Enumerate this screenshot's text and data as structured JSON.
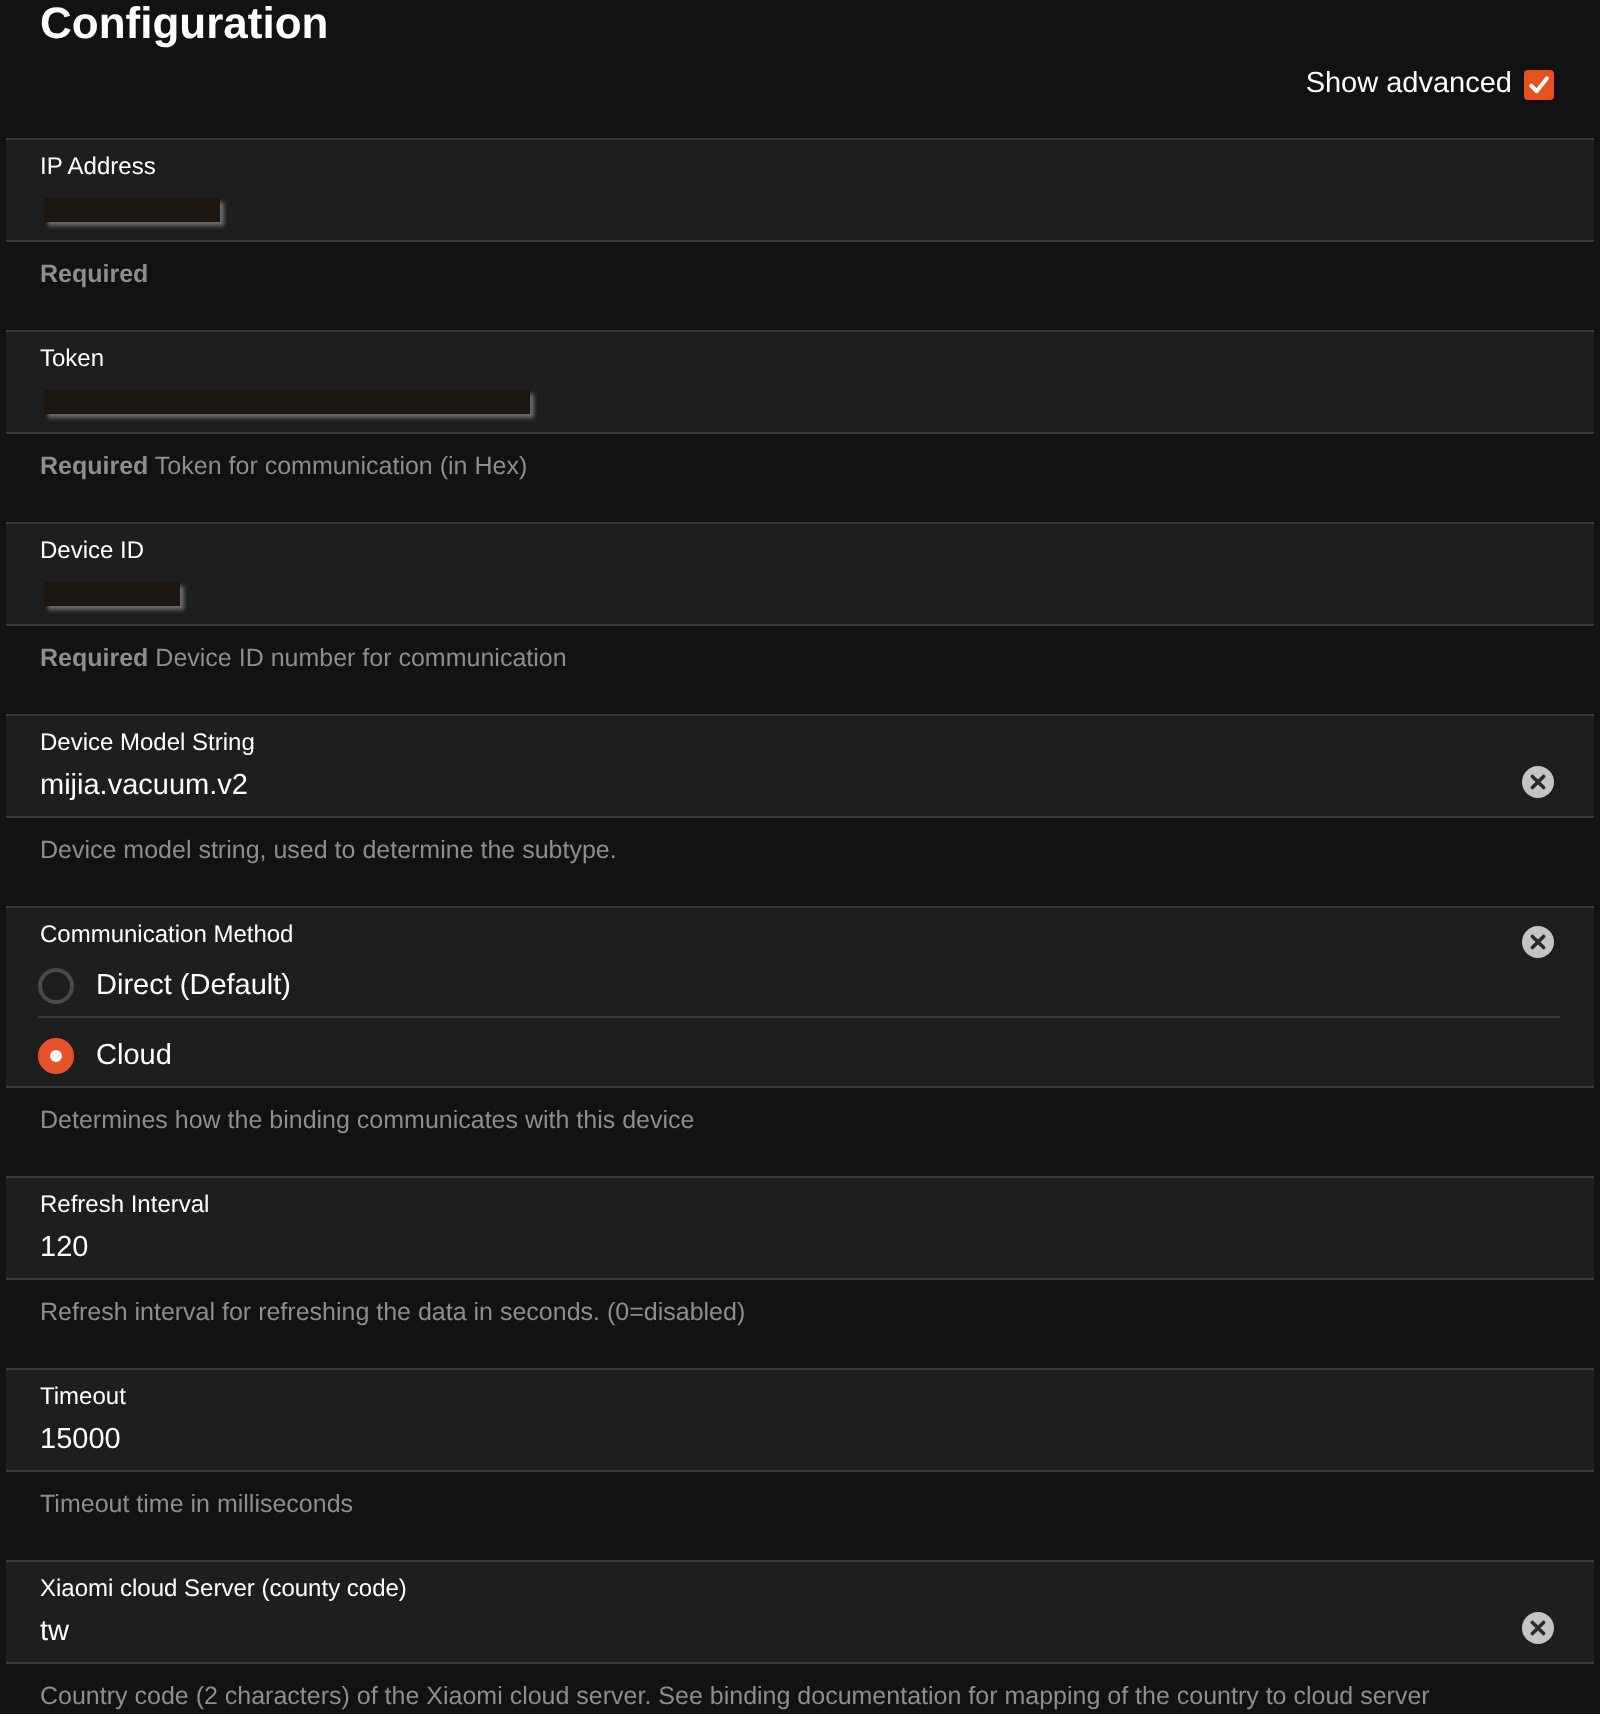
{
  "page": {
    "title": "Configuration"
  },
  "show_advanced": {
    "label": "Show advanced",
    "checked": true
  },
  "fields": [
    {
      "kind": "text",
      "label": "IP Address",
      "redacted": true,
      "clearable": false,
      "required": "Required"
    },
    {
      "kind": "text",
      "label": "Token",
      "redacted": true,
      "clearable": false,
      "required": "Required",
      "hint": "Token for communication (in Hex)"
    },
    {
      "kind": "text",
      "label": "Device ID",
      "redacted": true,
      "clearable": false,
      "required": "Required",
      "hint": "Device ID number for communication"
    },
    {
      "kind": "text",
      "label": "Device Model String",
      "value": "mijia.vacuum.v2",
      "redacted": false,
      "clearable": true,
      "hint": "Device model string, used to determine the subtype."
    },
    {
      "kind": "radio",
      "label": "Communication Method",
      "clearable": true,
      "options": [
        {
          "label": "Direct (Default)",
          "selected": false
        },
        {
          "label": "Cloud",
          "selected": true
        }
      ],
      "hint": "Determines how the binding communicates with this device"
    },
    {
      "kind": "text",
      "label": "Refresh Interval",
      "value": "120",
      "redacted": false,
      "clearable": false,
      "hint": "Refresh interval for refreshing the data in seconds. (0=disabled)"
    },
    {
      "kind": "text",
      "label": "Timeout",
      "value": "15000",
      "redacted": false,
      "clearable": false,
      "hint": "Timeout time in milliseconds"
    },
    {
      "kind": "text",
      "label": "Xiaomi cloud Server (county code)",
      "value": "tw",
      "redacted": false,
      "clearable": true,
      "hint": "Country code (2 characters) of the Xiaomi cloud server. See binding documentation for mapping of the country to cloud server"
    }
  ]
}
